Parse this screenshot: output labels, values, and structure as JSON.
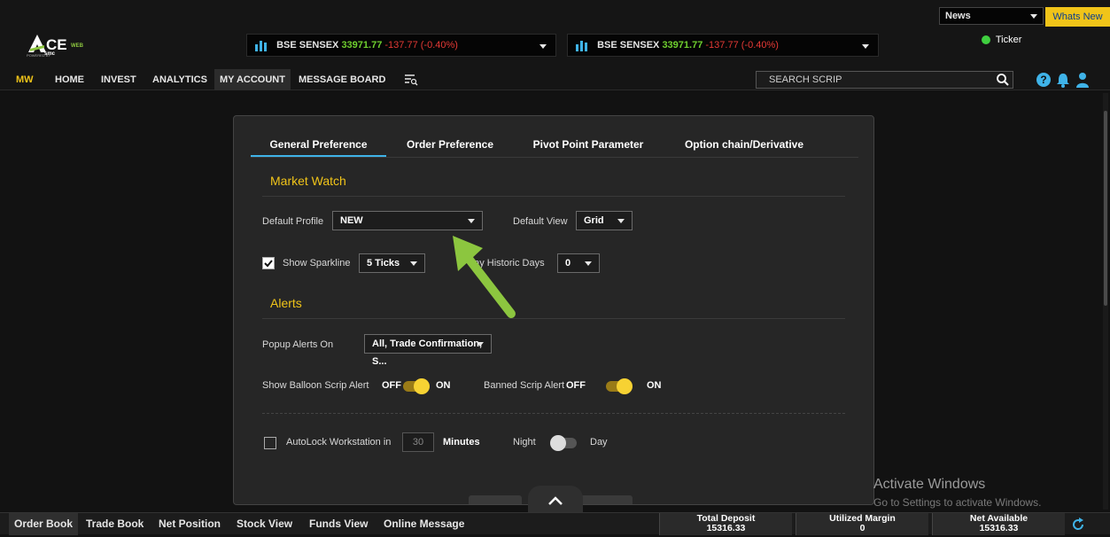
{
  "header": {
    "news_select": "News",
    "whats_new": "Whats New",
    "ticker_label": "Ticker",
    "logo": {
      "title": "CE",
      "sub": "WEB",
      "powered": "POWERED BY",
      "brand": "smc"
    },
    "tickers": [
      {
        "name": "BSE SENSEX",
        "value": "33971.77",
        "change": "-137.77",
        "pct": "(-0.40%)"
      },
      {
        "name": "BSE SENSEX",
        "value": "33971.77",
        "change": "-137.77",
        "pct": "(-0.40%)"
      }
    ]
  },
  "nav": {
    "items": [
      "MW",
      "HOME",
      "INVEST",
      "ANALYTICS",
      "MY ACCOUNT",
      "MESSAGE BOARD"
    ],
    "search_placeholder": "SEARCH SCRIP"
  },
  "panel": {
    "tabs": [
      "General Preference",
      "Order Preference",
      "Pivot Point Parameter",
      "Option chain/Derivative"
    ],
    "market_watch": {
      "title": "Market Watch",
      "default_profile_label": "Default Profile",
      "default_profile_value": "NEW",
      "default_view_label": "Default View",
      "default_view_value": "Grid",
      "show_sparkline_label": "Show Sparkline",
      "sparkline_value": "5 Ticks",
      "historic_days_label": "day Historic Days",
      "historic_days_value": "0"
    },
    "alerts": {
      "title": "Alerts",
      "popup_label": "Popup Alerts On",
      "popup_value": "All, Trade Confirmation, S...",
      "balloon_label": "Show Balloon Scrip Alert",
      "banned_label": "Banned Scrip Alert",
      "off": "OFF",
      "on": "ON"
    },
    "autolock": {
      "label": "AutoLock Workstation in",
      "value": "30",
      "unit": "Minutes",
      "night": "Night",
      "day": "Day"
    }
  },
  "bottom": {
    "tabs": [
      "Order Book",
      "Trade Book",
      "Net Position",
      "Stock View",
      "Funds View",
      "Online Message"
    ],
    "stats": [
      {
        "label": "Total Deposit",
        "value": "15316.33"
      },
      {
        "label": "Utilized Margin",
        "value": "0"
      },
      {
        "label": "Net Available",
        "value": "15316.33"
      }
    ]
  },
  "watermark": {
    "line1": "Activate Windows",
    "line2": "Go to Settings to activate Windows."
  },
  "colors": {
    "accent": "#f0c419",
    "tab_underline": "#3fb3e8",
    "up": "#6fcf2f",
    "down": "#e53935",
    "arrow": "#8cc63f"
  }
}
